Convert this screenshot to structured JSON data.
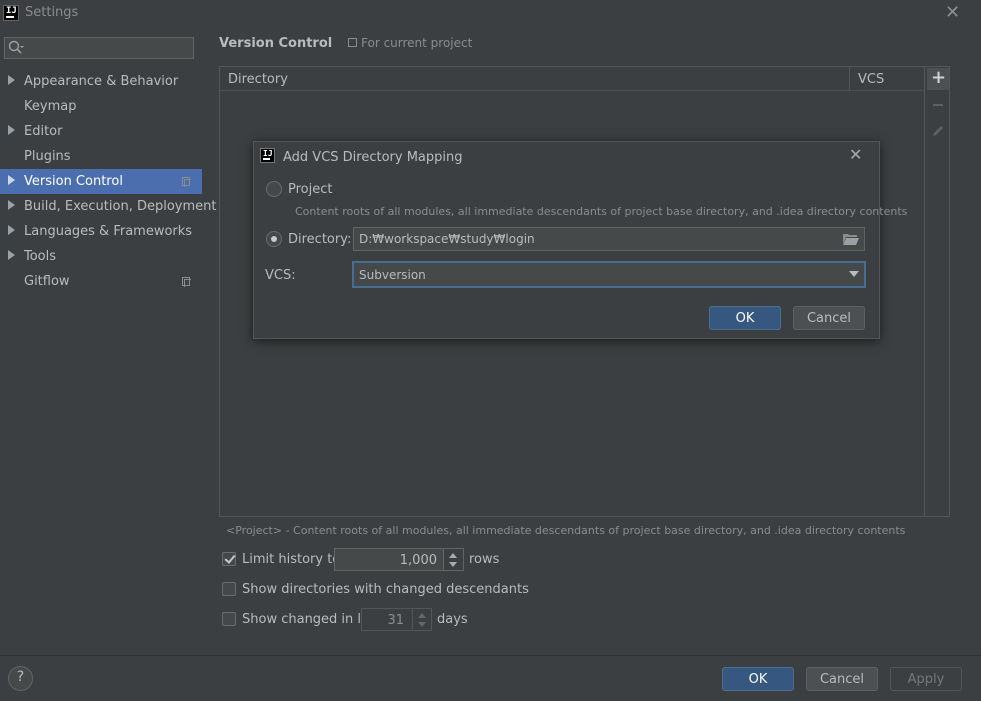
{
  "window": {
    "title": "Settings",
    "close_glyph": "✕"
  },
  "sidebar": {
    "search_placeholder": "",
    "items": [
      {
        "label": "Appearance & Behavior",
        "expandable": true
      },
      {
        "label": "Keymap",
        "expandable": false
      },
      {
        "label": "Editor",
        "expandable": true
      },
      {
        "label": "Plugins",
        "expandable": false
      },
      {
        "label": "Version Control",
        "expandable": true,
        "selected": true
      },
      {
        "label": "Build, Execution, Deployment",
        "expandable": true
      },
      {
        "label": "Languages & Frameworks",
        "expandable": true
      },
      {
        "label": "Tools",
        "expandable": true
      },
      {
        "label": "Gitflow",
        "expandable": false
      }
    ]
  },
  "main": {
    "section_title": "Version Control",
    "scope_note": "For current project",
    "table": {
      "columns": [
        "Directory",
        "VCS"
      ]
    },
    "toolbar": {
      "add_glyph": "+"
    },
    "hint": "<Project> - Content roots of all modules, all immediate descendants of project base directory, and .idea directory contents",
    "options": {
      "limit_history_label": "Limit history to:",
      "limit_history_value": "1,000",
      "limit_history_unit": "rows",
      "limit_history_checked": true,
      "show_dirs_label": "Show directories with changed descendants",
      "show_dirs_checked": false,
      "show_changed_label": "Show changed in last",
      "show_changed_value": "31",
      "show_changed_unit": "days",
      "show_changed_checked": false
    }
  },
  "footer": {
    "help_label": "?",
    "ok_label": "OK",
    "cancel_label": "Cancel",
    "apply_label": "Apply"
  },
  "dialog": {
    "title": "Add VCS Directory Mapping",
    "close_glyph": "✕",
    "project_label": "Project",
    "project_description": "Content roots of all modules, all immediate descendants of project base directory, and .idea directory contents",
    "directory_label": "Directory:",
    "directory_value": "D:₩workspace₩study₩login",
    "vcs_label": "VCS:",
    "vcs_value": "Subversion",
    "selected_option": "directory",
    "ok_label": "OK",
    "cancel_label": "Cancel"
  },
  "colors": {
    "background": "#3c3f41",
    "selection": "#4b6eaf",
    "primary_button": "#365880",
    "focus_border": "#466d94"
  },
  "icons": {
    "app": "intellij-logo-icon",
    "search": "search-icon",
    "folder": "folder-open-icon",
    "edit": "pencil-icon",
    "copy": "project-scope-icon"
  }
}
